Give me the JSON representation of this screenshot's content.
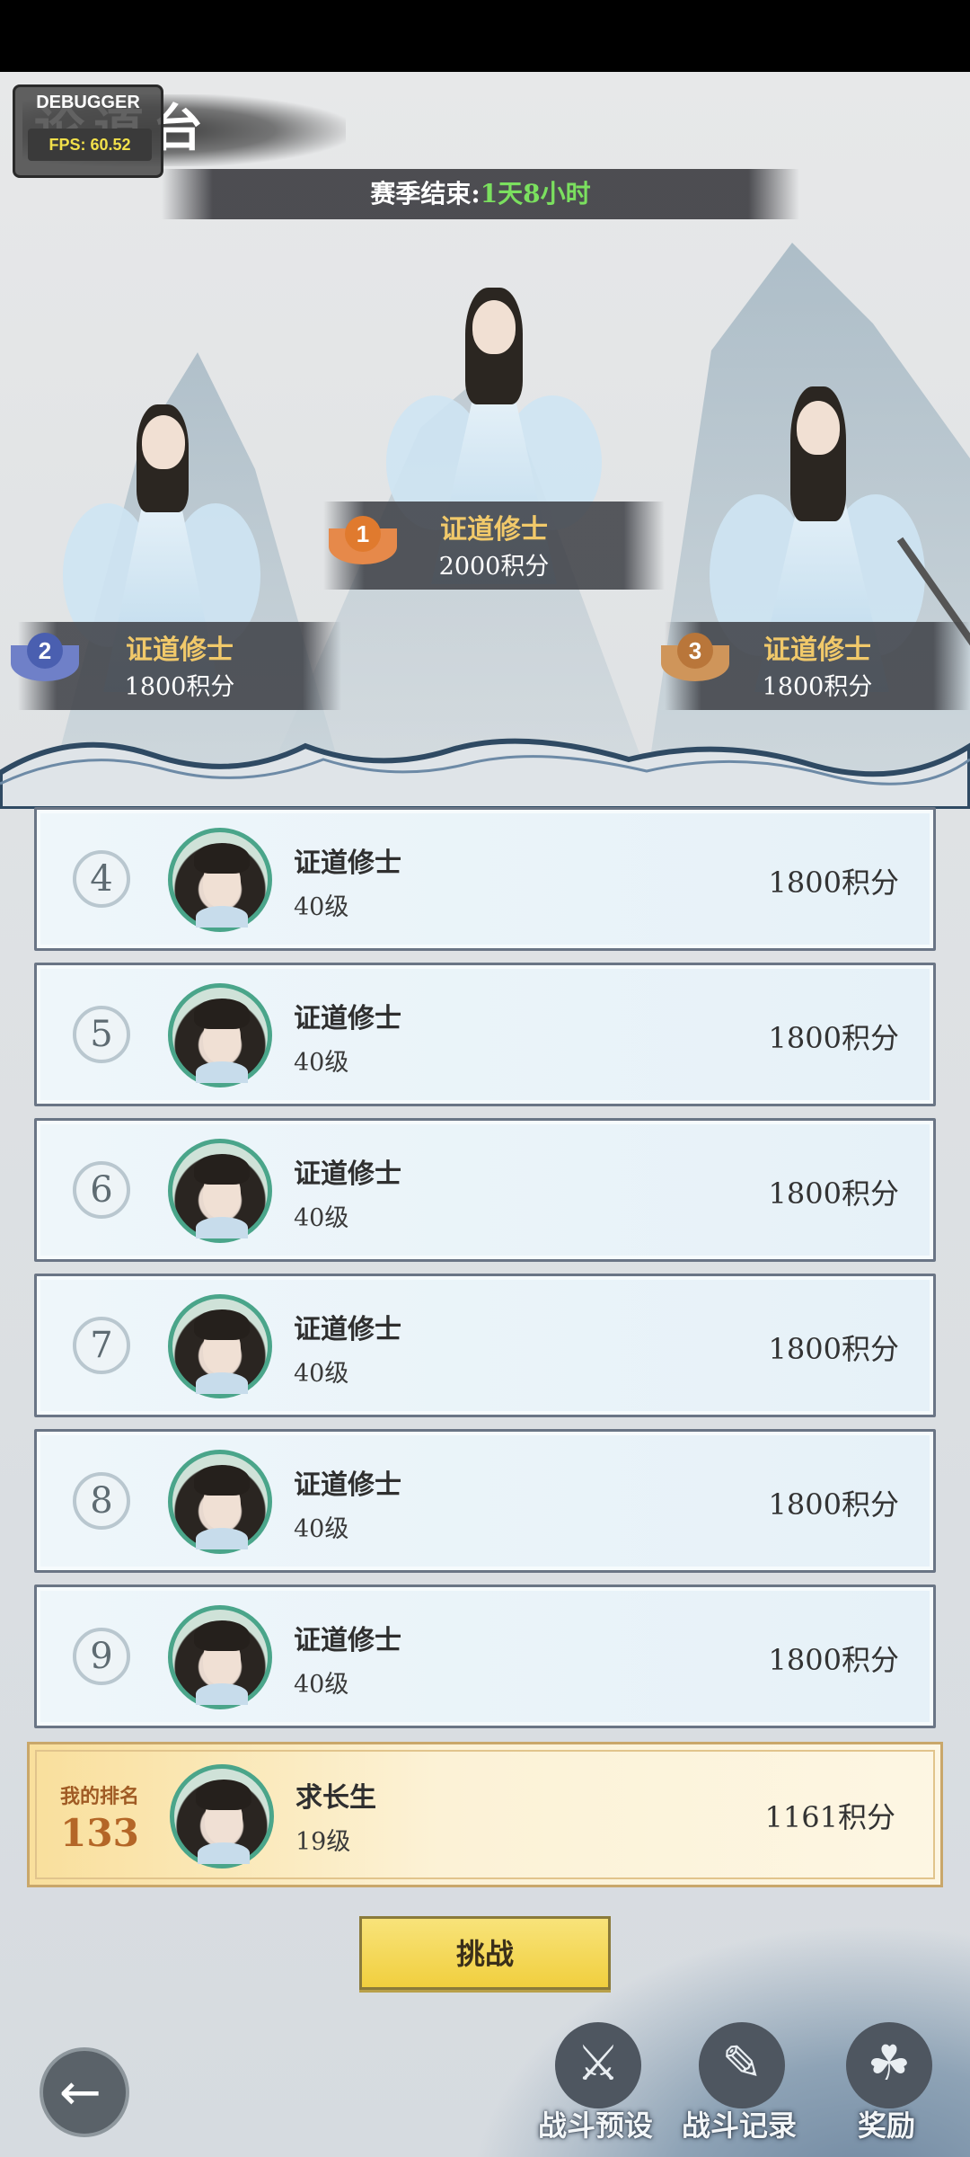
{
  "header": {
    "title": "论道台",
    "debugger_label": "DEBUGGER",
    "fps_label": "FPS: 60.52",
    "season_prefix": "赛季结束:",
    "season_timer": "1天8小时"
  },
  "podium": [
    {
      "rank": "1",
      "name": "证道修士",
      "score": "2000积分",
      "medal_color": "#e07a2e"
    },
    {
      "rank": "2",
      "name": "证道修士",
      "score": "1800积分",
      "medal_color": "#4a5fb0"
    },
    {
      "rank": "3",
      "name": "证道修士",
      "score": "1800积分",
      "medal_color": "#b9763a"
    }
  ],
  "rankings": [
    {
      "rank": "4",
      "name": "证道修士",
      "level": "40级",
      "score": "1800积分"
    },
    {
      "rank": "5",
      "name": "证道修士",
      "level": "40级",
      "score": "1800积分"
    },
    {
      "rank": "6",
      "name": "证道修士",
      "level": "40级",
      "score": "1800积分"
    },
    {
      "rank": "7",
      "name": "证道修士",
      "level": "40级",
      "score": "1800积分"
    },
    {
      "rank": "8",
      "name": "证道修士",
      "level": "40级",
      "score": "1800积分"
    },
    {
      "rank": "9",
      "name": "证道修士",
      "level": "40级",
      "score": "1800积分"
    }
  ],
  "my_rank": {
    "label": "我的排名",
    "rank": "133",
    "name": "求长生",
    "level": "19级",
    "score": "1161积分"
  },
  "actions": {
    "challenge_label": "挑战",
    "back_icon": "arrow-left-icon",
    "preset_label": "战斗预设",
    "record_label": "战斗记录",
    "reward_label": "奖励"
  }
}
